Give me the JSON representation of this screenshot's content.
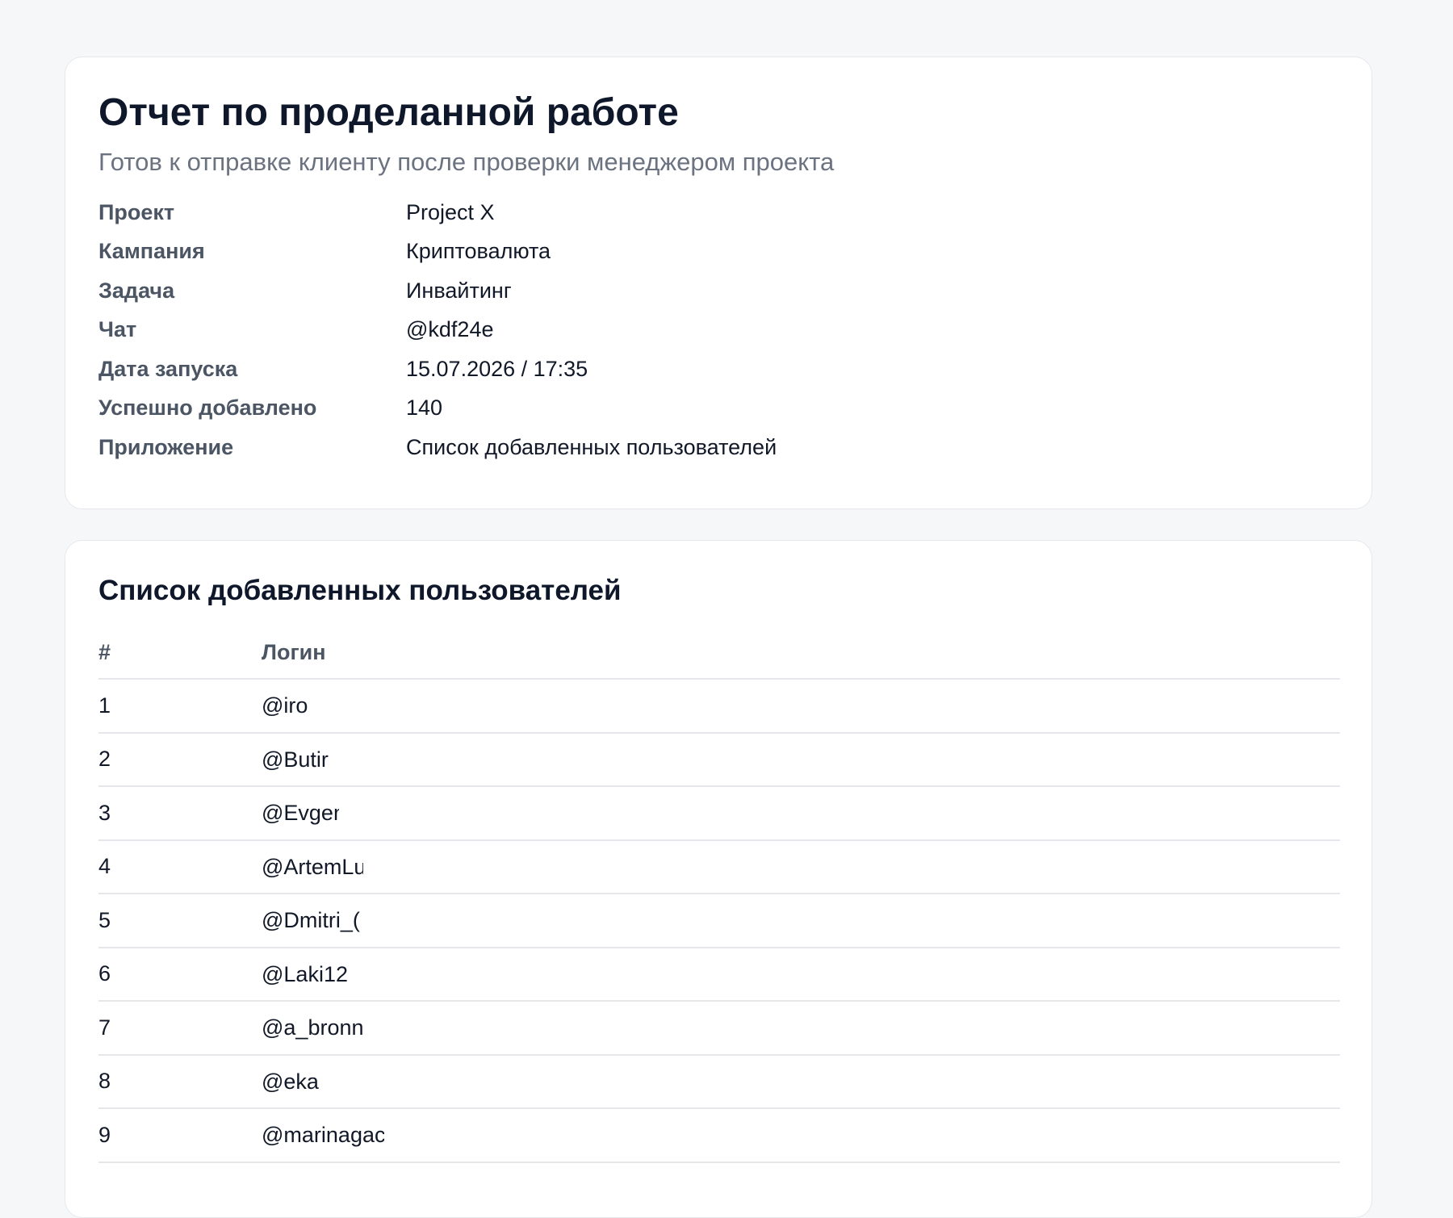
{
  "report": {
    "title": "Отчет по проделанной работе",
    "subtitle": "Готов к отправке клиенту после проверки менеджером проекта",
    "fields": [
      {
        "label": "Проект",
        "value": "Project X"
      },
      {
        "label": "Кампания",
        "value": "Криптовалюта"
      },
      {
        "label": "Задача",
        "value": "Инвайтинг"
      },
      {
        "label": "Чат",
        "value": "@kdf24e"
      },
      {
        "label": "Дата запуска",
        "value": "15.07.2026 / 17:35"
      },
      {
        "label": "Успешно добавлено",
        "value": "140"
      },
      {
        "label": "Приложение",
        "value": "Список добавленных пользователей"
      }
    ]
  },
  "users_list": {
    "title": "Список добавленных пользователей",
    "columns": [
      "#",
      "Логин"
    ],
    "rows": [
      {
        "num": "1",
        "login": "@iro"
      },
      {
        "num": "2",
        "login": "@Butir"
      },
      {
        "num": "3",
        "login": "@Evgen"
      },
      {
        "num": "4",
        "login": "@ArtemLu"
      },
      {
        "num": "5",
        "login": "@Dmitri_("
      },
      {
        "num": "6",
        "login": "@Laki12"
      },
      {
        "num": "7",
        "login": "@a_bronn"
      },
      {
        "num": "8",
        "login": "@eka"
      },
      {
        "num": "9",
        "login": "@marinagac"
      }
    ]
  }
}
